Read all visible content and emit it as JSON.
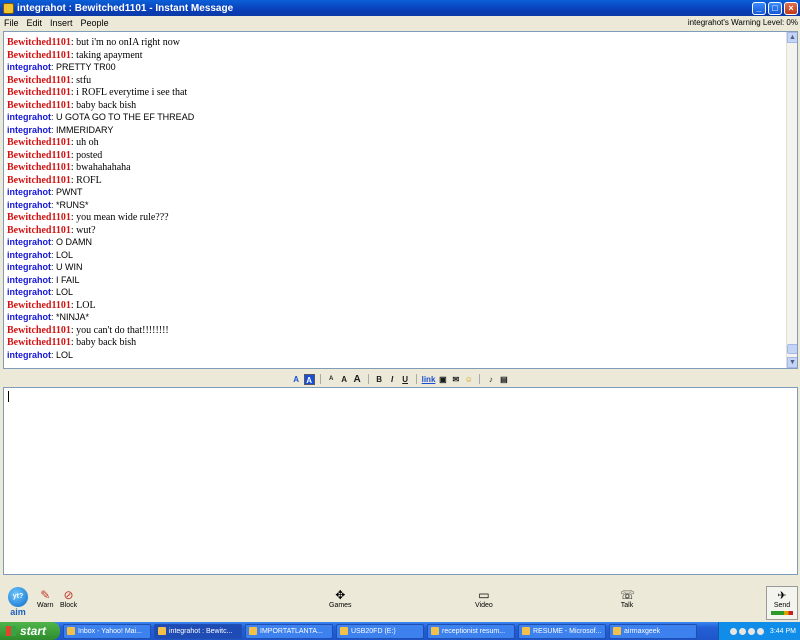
{
  "window": {
    "title": "integrahot : Bewitched1101 - Instant Message",
    "buttons": [
      "_",
      "□",
      "×"
    ]
  },
  "menu": {
    "items": [
      "File",
      "Edit",
      "Insert",
      "People"
    ],
    "warning_level": "integrahot's Warning Level: 0%"
  },
  "conversation": [
    {
      "user": "Bewitched1101",
      "text": ": but i'm no onIA right now"
    },
    {
      "user": "Bewitched1101",
      "text": ": taking apayment"
    },
    {
      "user": "integrahot",
      "text": ": PRETTY TR00"
    },
    {
      "user": "Bewitched1101",
      "text": ": stfu"
    },
    {
      "user": "Bewitched1101",
      "text": ": i ROFL everytime i see that"
    },
    {
      "user": "Bewitched1101",
      "text": ": baby back bish"
    },
    {
      "user": "integrahot",
      "text": ": U GOTA GO TO THE EF THREAD"
    },
    {
      "user": "integrahot",
      "text": ": IMMERIDARY"
    },
    {
      "user": "Bewitched1101",
      "text": ": uh oh"
    },
    {
      "user": "Bewitched1101",
      "text": ": posted"
    },
    {
      "user": "Bewitched1101",
      "text": ": bwahahahaha"
    },
    {
      "user": "Bewitched1101",
      "text": ": ROFL"
    },
    {
      "user": "integrahot",
      "text": ": PWNT"
    },
    {
      "user": "integrahot",
      "text": ": *RUNS*"
    },
    {
      "user": "Bewitched1101",
      "text": ": you mean wide rule???"
    },
    {
      "user": "Bewitched1101",
      "text": ": wut?"
    },
    {
      "user": "integrahot",
      "text": ": O DAMN"
    },
    {
      "user": "integrahot",
      "text": ": LOL"
    },
    {
      "user": "integrahot",
      "text": ": U WIN"
    },
    {
      "user": "integrahot",
      "text": ": I FAIL"
    },
    {
      "user": "integrahot",
      "text": ": LOL"
    },
    {
      "user": "Bewitched1101",
      "text": ": LOL"
    },
    {
      "user": "integrahot",
      "text": ": *NINJA*"
    },
    {
      "user": "Bewitched1101",
      "text": ": you can't do that!!!!!!!!"
    },
    {
      "user": "Bewitched1101",
      "text": ": baby back bish"
    },
    {
      "user": "integrahot",
      "text": ": LOL"
    }
  ],
  "format_toolbar": {
    "buttons": [
      "A",
      "A",
      "A",
      "A",
      "A",
      "B",
      "I",
      "U",
      "link",
      "img",
      "mail",
      "smiley",
      "sound",
      "attach"
    ],
    "icons": {
      "link": "link-icon",
      "img": "image-icon",
      "mail": "mail-icon",
      "smiley": "smiley-icon",
      "sound": "sound-icon",
      "attach": "attach-icon"
    }
  },
  "actions": {
    "warn": "Warn",
    "block": "Block",
    "games": "Games",
    "video": "Video",
    "talk": "Talk",
    "send": "Send",
    "logo": "aim",
    "logo_badge": "yt?"
  },
  "taskbar": {
    "start": "start",
    "items": [
      "Inbox - Yahoo! Mai...",
      "integrahot : Bewitc...",
      "IMPORTATLANTA...",
      "USB20FD (E:)",
      "receptionist resum...",
      "RESUME - Microsof...",
      "airmaxgeek"
    ],
    "active_index": 1,
    "clock": "3:44 PM"
  },
  "colors": {
    "bewitched": "#d31212",
    "integrahot": "#1414d6",
    "titlebar": "#0a3fb8",
    "taskbar": "#2460d8"
  }
}
